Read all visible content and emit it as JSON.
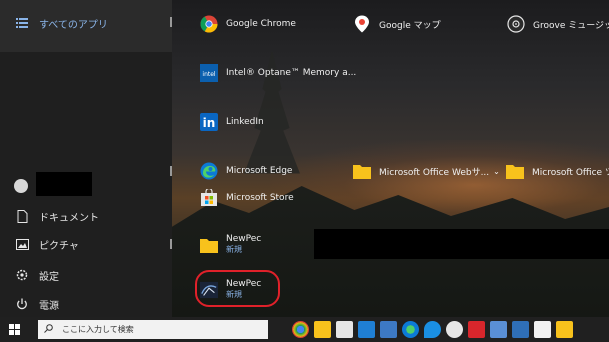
{
  "rail": {
    "all_apps_label": "すべてのアプリ",
    "items": [
      {
        "label": "ドキュメント",
        "icon": "document-icon"
      },
      {
        "label": "ピクチャ",
        "icon": "pictures-icon"
      },
      {
        "label": "設定",
        "icon": "settings-gear-icon"
      },
      {
        "label": "電源",
        "icon": "power-icon"
      }
    ]
  },
  "apps": {
    "chrome": "Google Chrome",
    "maps": "Google マップ",
    "groove": "Groove ミュージック",
    "optane": "Intel® Optane™ Memory a...",
    "linkedin": "LinkedIn",
    "edge": "Microsoft Edge",
    "office_web": "Microsoft Office Webサ...",
    "office": "Microsoft Office ツ",
    "store": "Microsoft Store",
    "newpec1": {
      "name": "NewPec",
      "sub": "新規"
    },
    "newpec2": {
      "name": "NewPec",
      "sub": "新規"
    }
  },
  "taskbar": {
    "search_placeholder": "ここに入力して検索",
    "pinned": [
      "chrome-icon",
      "file-explorer-icon",
      "calendar-icon",
      "mail-icon",
      "app-icon",
      "edge-icon",
      "drop-icon",
      "chrome-alt-icon",
      "adobe-illustrator-icon",
      "paint-icon",
      "photo-icon",
      "docs-icon",
      "folder-icon"
    ]
  },
  "colors": {
    "accent": "#8ab4e8",
    "highlight": "#e0212a",
    "taskbar": "#202020"
  }
}
